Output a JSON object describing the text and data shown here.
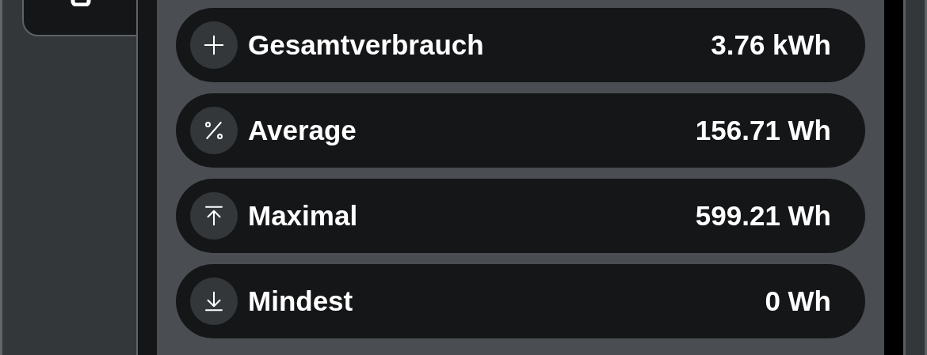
{
  "stats": [
    {
      "kind": "plus",
      "label": "Gesamtverbrauch",
      "value": "3.76 kWh"
    },
    {
      "kind": "percent",
      "label": "Average",
      "value": "156.71 Wh"
    },
    {
      "kind": "max",
      "label": "Maximal",
      "value": "599.21 Wh"
    },
    {
      "kind": "min",
      "label": "Mindest",
      "value": "0 Wh"
    }
  ]
}
